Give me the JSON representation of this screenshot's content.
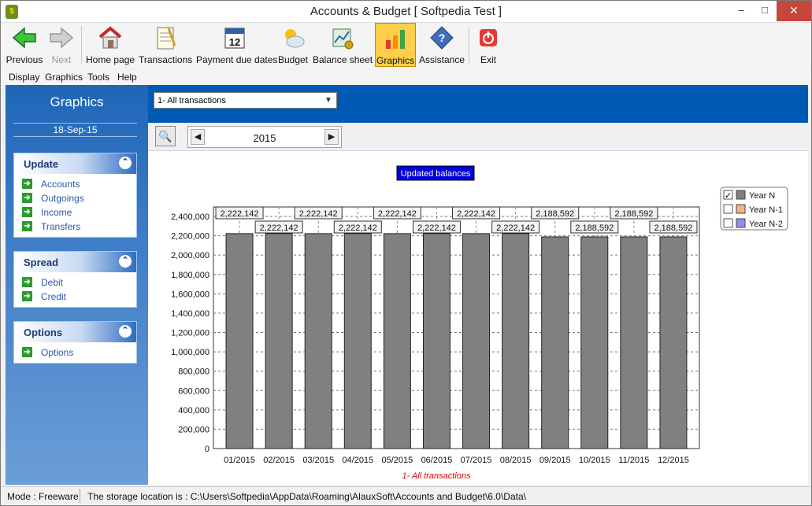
{
  "window": {
    "title": "Accounts & Budget [ Softpedia Test ]",
    "app_icon_glyph": "$"
  },
  "window_controls": {
    "minimize": "–",
    "maximize": "□",
    "close": "✕"
  },
  "toolbar": [
    {
      "label": "Previous",
      "icon": "back-arrow-icon",
      "enabled": true
    },
    {
      "label": "Next",
      "icon": "forward-arrow-icon",
      "enabled": false
    },
    {
      "label": "Home page",
      "icon": "home-icon",
      "enabled": true
    },
    {
      "label": "Transactions",
      "icon": "notepad-icon",
      "enabled": true
    },
    {
      "label": "Payment due dates",
      "icon": "calendar-icon",
      "enabled": true
    },
    {
      "label": "Budget",
      "icon": "weather-icon",
      "enabled": true
    },
    {
      "label": "Balance sheet",
      "icon": "balance-sheet-icon",
      "enabled": true
    },
    {
      "label": "Graphics",
      "icon": "bar-chart-icon",
      "enabled": true,
      "selected": true
    },
    {
      "label": "Assistance",
      "icon": "help-diamond-icon",
      "enabled": true
    },
    {
      "label": "Exit",
      "icon": "power-icon",
      "enabled": true
    }
  ],
  "menu": [
    "Display",
    "Graphics",
    "Tools",
    "Help"
  ],
  "left_pane": {
    "title": "Graphics",
    "date": "18-Sep-15",
    "panels": [
      {
        "title": "Update",
        "items": [
          "Accounts",
          "Outgoings",
          "Income",
          "Transfers"
        ]
      },
      {
        "title": "Spread",
        "items": [
          "Debit",
          "Credit"
        ]
      },
      {
        "title": "Options",
        "items": [
          "Options"
        ]
      }
    ]
  },
  "filter": {
    "selected": "1- All transactions"
  },
  "year_nav": {
    "year": "2015"
  },
  "chart_data": {
    "type": "bar",
    "title": "Updated balances",
    "caption": "1- All transactions",
    "categories": [
      "01/2015",
      "02/2015",
      "03/2015",
      "04/2015",
      "05/2015",
      "06/2015",
      "07/2015",
      "08/2015",
      "09/2015",
      "10/2015",
      "11/2015",
      "12/2015"
    ],
    "series": [
      {
        "name": "Year N",
        "values": [
          2222142,
          2222142,
          2222142,
          2222142,
          2222142,
          2222142,
          2222142,
          2222142,
          2188592,
          2188592,
          2188592,
          2188592
        ],
        "color": "#808080",
        "checked": true
      },
      {
        "name": "Year N-1",
        "values": [],
        "color": "#f4b183",
        "checked": false
      },
      {
        "name": "Year N-2",
        "values": [],
        "color": "#8e8ef0",
        "checked": false
      }
    ],
    "data_labels": [
      "2,222,142",
      "2,222,142",
      "2,222,142",
      "2,222,142",
      "2,222,142",
      "2,222,142",
      "2,222,142",
      "2,222,142",
      "2,188,592",
      "2,188,592",
      "2,188,592",
      "2,188,592"
    ],
    "y_ticks": [
      "0",
      "200,000",
      "400,000",
      "600,000",
      "800,000",
      "1,000,000",
      "1,200,000",
      "1,400,000",
      "1,600,000",
      "1,800,000",
      "2,000,000",
      "2,200,000",
      "2,400,000"
    ],
    "ylim": [
      0,
      2400000
    ],
    "grid": true,
    "legend_position": "top-right",
    "title_color": "#0000dd",
    "caption_color": "#dd0000"
  },
  "status": {
    "mode": "Mode : Freeware",
    "storage": "The storage location is : C:\\Users\\Softpedia\\AppData\\Roaming\\AlauxSoft\\Accounts and Budget\\6.0\\Data\\"
  }
}
